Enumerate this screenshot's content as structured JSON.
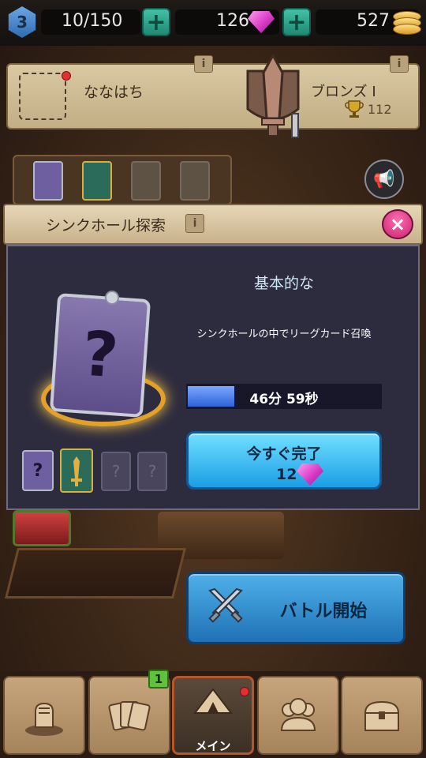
{
  "topbar": {
    "level": "3",
    "energy": "10/150",
    "gems": "126",
    "coins": "527"
  },
  "profile": {
    "player_name": "ななはち",
    "rank_name": "ブロンズ I",
    "trophies": "112",
    "info_icon": "i"
  },
  "modal": {
    "title": "シンクホール探索",
    "info_icon": "i",
    "close_icon": "×",
    "variant_title": "基本的な",
    "description": "シンクホールの中でリーグカード召喚",
    "timer_text": "46分 59秒",
    "timer_progress": 0.24,
    "finish_label": "今すぐ完了",
    "finish_cost": "12"
  },
  "main": {
    "battle_label": "バトル開始"
  },
  "bottom_nav": {
    "badge_count": "1",
    "tabs": [
      {
        "icon": "fist-icon"
      },
      {
        "icon": "cards-icon"
      },
      {
        "icon": "tent-icon",
        "label": "メイン"
      },
      {
        "icon": "guild-icon"
      },
      {
        "icon": "chest-icon"
      }
    ]
  },
  "colors": {
    "accent_blue": "#1b9ee6",
    "gem_pink": "#d436c2",
    "close_pink": "#c8206f",
    "badge_green": "#5ec23a"
  }
}
